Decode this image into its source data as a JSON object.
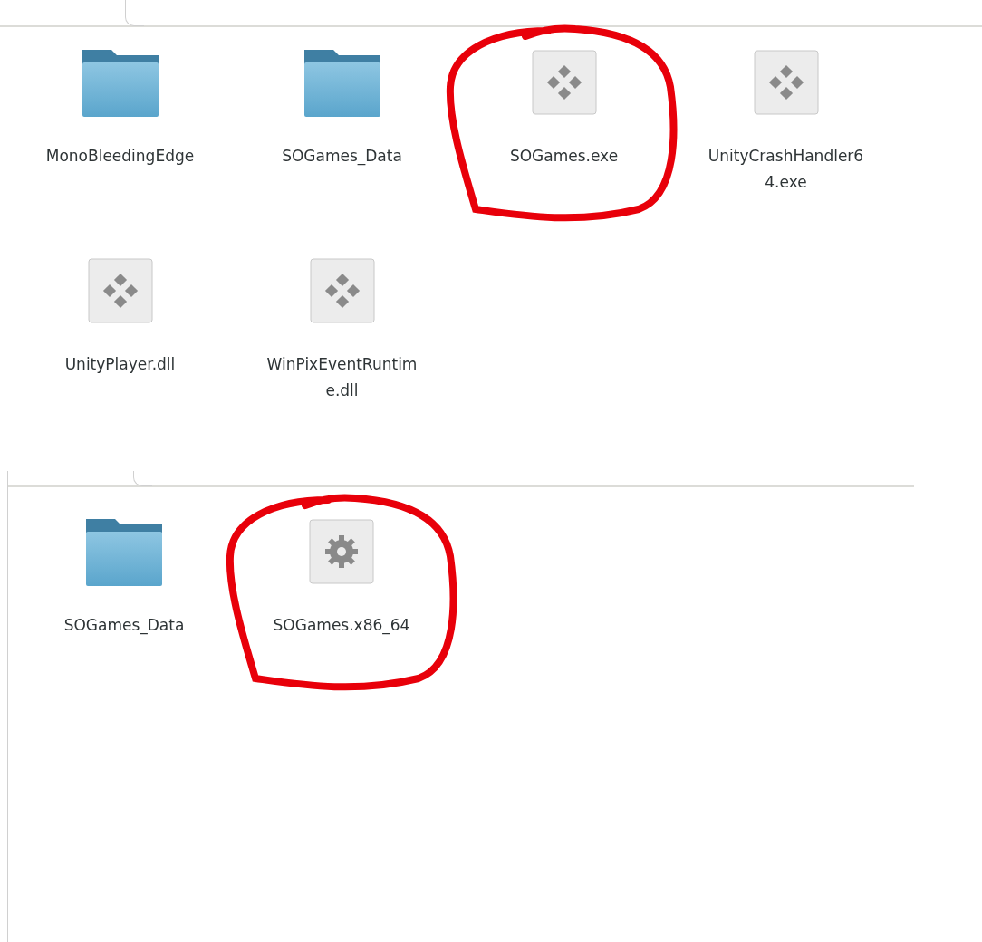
{
  "windows": [
    {
      "items": [
        {
          "kind": "folder",
          "name": "MonoBleedingEdge",
          "circled": false
        },
        {
          "kind": "folder",
          "name": "SOGames_Data",
          "circled": false
        },
        {
          "kind": "exe",
          "name": "SOGames.exe",
          "circled": true
        },
        {
          "kind": "exe",
          "name": "UnityCrashHandler64.exe",
          "circled": false
        },
        {
          "kind": "exe",
          "name": "UnityPlayer.dll",
          "circled": false
        },
        {
          "kind": "exe",
          "name": "WinPixEventRuntime.dll",
          "circled": false
        }
      ]
    },
    {
      "items": [
        {
          "kind": "folder",
          "name": "SOGames_Data",
          "circled": false
        },
        {
          "kind": "binary",
          "name": "SOGames.x86_64",
          "circled": true
        }
      ]
    }
  ]
}
